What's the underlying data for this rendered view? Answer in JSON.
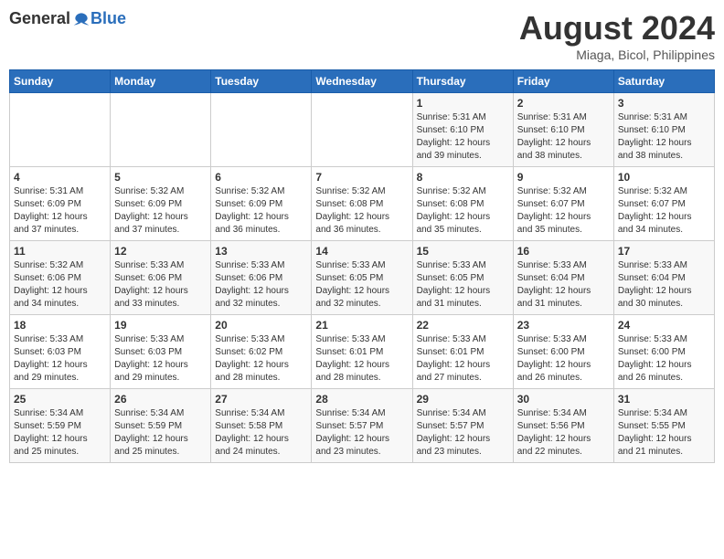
{
  "header": {
    "logo": {
      "general": "General",
      "blue": "Blue"
    },
    "title": "August 2024",
    "location": "Miaga, Bicol, Philippines"
  },
  "weekdays": [
    "Sunday",
    "Monday",
    "Tuesday",
    "Wednesday",
    "Thursday",
    "Friday",
    "Saturday"
  ],
  "weeks": [
    [
      {
        "day": "",
        "detail": ""
      },
      {
        "day": "",
        "detail": ""
      },
      {
        "day": "",
        "detail": ""
      },
      {
        "day": "",
        "detail": ""
      },
      {
        "day": "1",
        "detail": "Sunrise: 5:31 AM\nSunset: 6:10 PM\nDaylight: 12 hours\nand 39 minutes."
      },
      {
        "day": "2",
        "detail": "Sunrise: 5:31 AM\nSunset: 6:10 PM\nDaylight: 12 hours\nand 38 minutes."
      },
      {
        "day": "3",
        "detail": "Sunrise: 5:31 AM\nSunset: 6:10 PM\nDaylight: 12 hours\nand 38 minutes."
      }
    ],
    [
      {
        "day": "4",
        "detail": "Sunrise: 5:31 AM\nSunset: 6:09 PM\nDaylight: 12 hours\nand 37 minutes."
      },
      {
        "day": "5",
        "detail": "Sunrise: 5:32 AM\nSunset: 6:09 PM\nDaylight: 12 hours\nand 37 minutes."
      },
      {
        "day": "6",
        "detail": "Sunrise: 5:32 AM\nSunset: 6:09 PM\nDaylight: 12 hours\nand 36 minutes."
      },
      {
        "day": "7",
        "detail": "Sunrise: 5:32 AM\nSunset: 6:08 PM\nDaylight: 12 hours\nand 36 minutes."
      },
      {
        "day": "8",
        "detail": "Sunrise: 5:32 AM\nSunset: 6:08 PM\nDaylight: 12 hours\nand 35 minutes."
      },
      {
        "day": "9",
        "detail": "Sunrise: 5:32 AM\nSunset: 6:07 PM\nDaylight: 12 hours\nand 35 minutes."
      },
      {
        "day": "10",
        "detail": "Sunrise: 5:32 AM\nSunset: 6:07 PM\nDaylight: 12 hours\nand 34 minutes."
      }
    ],
    [
      {
        "day": "11",
        "detail": "Sunrise: 5:32 AM\nSunset: 6:06 PM\nDaylight: 12 hours\nand 34 minutes."
      },
      {
        "day": "12",
        "detail": "Sunrise: 5:33 AM\nSunset: 6:06 PM\nDaylight: 12 hours\nand 33 minutes."
      },
      {
        "day": "13",
        "detail": "Sunrise: 5:33 AM\nSunset: 6:06 PM\nDaylight: 12 hours\nand 32 minutes."
      },
      {
        "day": "14",
        "detail": "Sunrise: 5:33 AM\nSunset: 6:05 PM\nDaylight: 12 hours\nand 32 minutes."
      },
      {
        "day": "15",
        "detail": "Sunrise: 5:33 AM\nSunset: 6:05 PM\nDaylight: 12 hours\nand 31 minutes."
      },
      {
        "day": "16",
        "detail": "Sunrise: 5:33 AM\nSunset: 6:04 PM\nDaylight: 12 hours\nand 31 minutes."
      },
      {
        "day": "17",
        "detail": "Sunrise: 5:33 AM\nSunset: 6:04 PM\nDaylight: 12 hours\nand 30 minutes."
      }
    ],
    [
      {
        "day": "18",
        "detail": "Sunrise: 5:33 AM\nSunset: 6:03 PM\nDaylight: 12 hours\nand 29 minutes."
      },
      {
        "day": "19",
        "detail": "Sunrise: 5:33 AM\nSunset: 6:03 PM\nDaylight: 12 hours\nand 29 minutes."
      },
      {
        "day": "20",
        "detail": "Sunrise: 5:33 AM\nSunset: 6:02 PM\nDaylight: 12 hours\nand 28 minutes."
      },
      {
        "day": "21",
        "detail": "Sunrise: 5:33 AM\nSunset: 6:01 PM\nDaylight: 12 hours\nand 28 minutes."
      },
      {
        "day": "22",
        "detail": "Sunrise: 5:33 AM\nSunset: 6:01 PM\nDaylight: 12 hours\nand 27 minutes."
      },
      {
        "day": "23",
        "detail": "Sunrise: 5:33 AM\nSunset: 6:00 PM\nDaylight: 12 hours\nand 26 minutes."
      },
      {
        "day": "24",
        "detail": "Sunrise: 5:33 AM\nSunset: 6:00 PM\nDaylight: 12 hours\nand 26 minutes."
      }
    ],
    [
      {
        "day": "25",
        "detail": "Sunrise: 5:34 AM\nSunset: 5:59 PM\nDaylight: 12 hours\nand 25 minutes."
      },
      {
        "day": "26",
        "detail": "Sunrise: 5:34 AM\nSunset: 5:59 PM\nDaylight: 12 hours\nand 25 minutes."
      },
      {
        "day": "27",
        "detail": "Sunrise: 5:34 AM\nSunset: 5:58 PM\nDaylight: 12 hours\nand 24 minutes."
      },
      {
        "day": "28",
        "detail": "Sunrise: 5:34 AM\nSunset: 5:57 PM\nDaylight: 12 hours\nand 23 minutes."
      },
      {
        "day": "29",
        "detail": "Sunrise: 5:34 AM\nSunset: 5:57 PM\nDaylight: 12 hours\nand 23 minutes."
      },
      {
        "day": "30",
        "detail": "Sunrise: 5:34 AM\nSunset: 5:56 PM\nDaylight: 12 hours\nand 22 minutes."
      },
      {
        "day": "31",
        "detail": "Sunrise: 5:34 AM\nSunset: 5:55 PM\nDaylight: 12 hours\nand 21 minutes."
      }
    ]
  ]
}
